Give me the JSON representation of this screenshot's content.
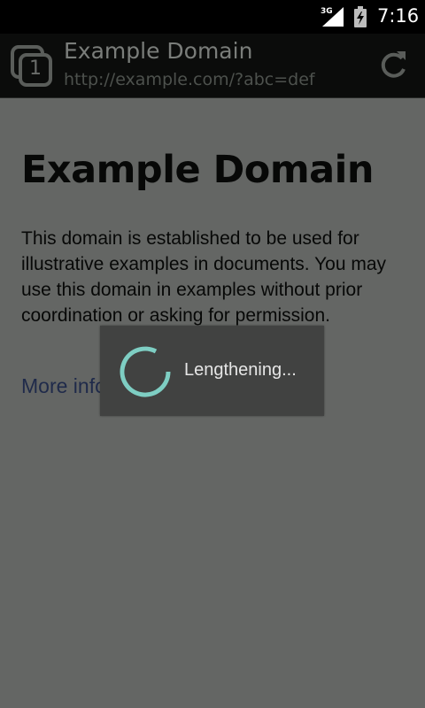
{
  "status_bar": {
    "network": "3G",
    "time": "7:16"
  },
  "toolbar": {
    "tab_count": "1",
    "page_title": "Example Domain",
    "url": "http://example.com/?abc=def"
  },
  "page": {
    "heading": "Example Domain",
    "body": "This domain is established to be used for illustrative examples in documents. You may use this domain in examples without prior coordination or asking for permission.",
    "link": "More information..."
  },
  "dialog": {
    "message": "Lengthening..."
  },
  "colors": {
    "spinner": "#7ecec3",
    "dim_overlay": "#646664",
    "dialog_bg": "#414241"
  }
}
